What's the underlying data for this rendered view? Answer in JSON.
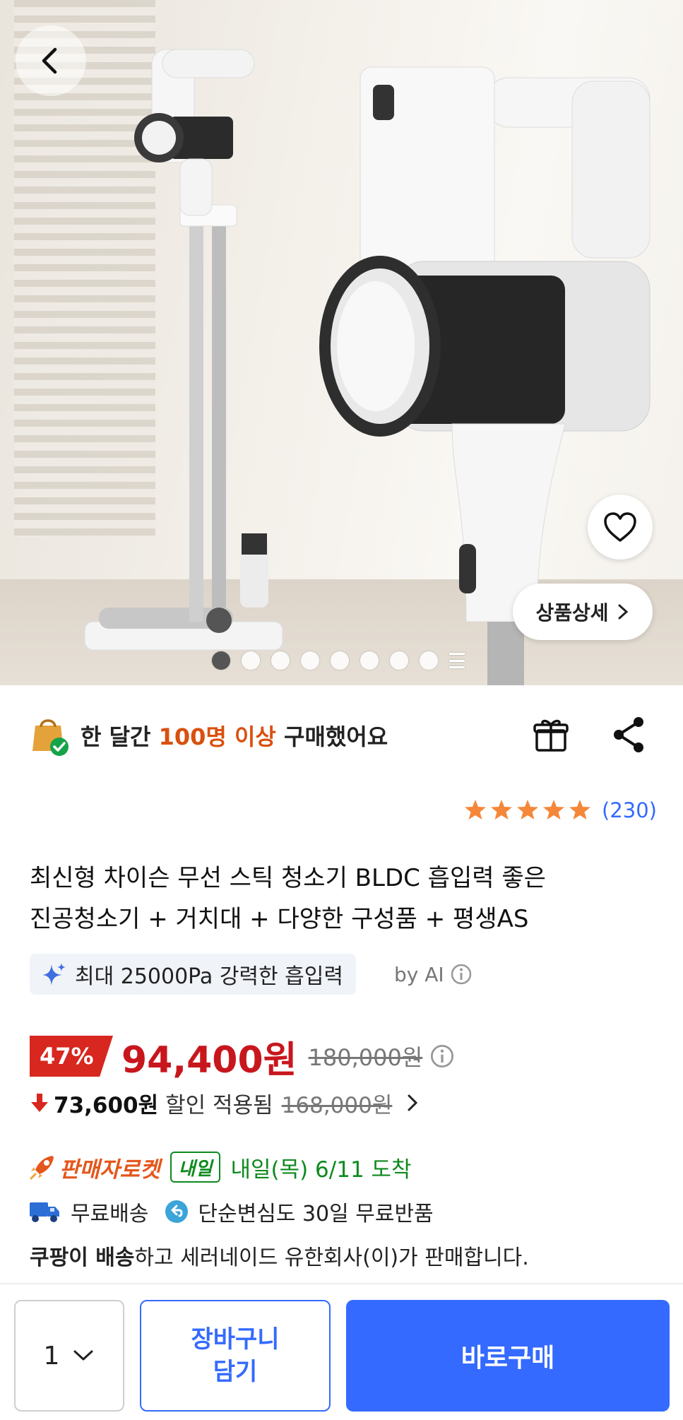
{
  "hero": {
    "slide_count": 8,
    "active_slide": 1,
    "detail_button_label": "상품상세"
  },
  "social_proof": {
    "prefix": "한 달간 ",
    "highlight": "100명 이상",
    "suffix": " 구매했어요"
  },
  "rating": {
    "stars": 5,
    "count": "(230)"
  },
  "product": {
    "title_line1": "최신형 차이슨 무선 스틱 청소기 BLDC 흡입력 좋은",
    "title_line2": "진공청소기 + 거치대 + 다양한 구성품 + 평생AS"
  },
  "ai_summary": {
    "text": "최대 25000Pa 강력한 흡입력",
    "by_label": "by AI"
  },
  "price": {
    "discount": "47%",
    "sale": "94,400원",
    "original": "180,000원"
  },
  "coupon": {
    "amount": "73,600원",
    "applied_text": "할인 적용됨",
    "before": "168,000원"
  },
  "delivery": {
    "rocket_label": "판매자로켓",
    "badge": "내일",
    "arrival": "내일(목) 6/11 도착",
    "free_shipping": "무료배송",
    "returns": "단순변심도 30일 무료반품"
  },
  "seller": {
    "bold": "쿠팡이 배송",
    "rest": "하고 세러네이드 유한회사(이)가 판매합니다."
  },
  "bottom_bar": {
    "quantity": "1",
    "cart_label": "장바구니\n담기",
    "buy_label": "바로구매"
  },
  "colors": {
    "accent_blue": "#346aff",
    "price_red": "#c8161d",
    "badge_red": "#d7271f",
    "delivery_green": "#0e8a1e",
    "rocket_orange": "#e4571c",
    "star": "#f5873a"
  }
}
